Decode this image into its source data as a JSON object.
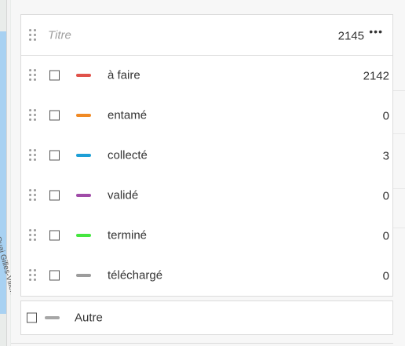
{
  "map": {
    "label": "Quai Gilles-Villeneu"
  },
  "legend": {
    "title_placeholder": "Titre",
    "total": "2145",
    "more_label": "•••",
    "items": [
      {
        "label": "à faire",
        "count": "2142",
        "color": "#e0524a"
      },
      {
        "label": "entamé",
        "count": "0",
        "color": "#f08a24"
      },
      {
        "label": "collecté",
        "count": "3",
        "color": "#1e9fd6"
      },
      {
        "label": "validé",
        "count": "0",
        "color": "#a04ca8"
      },
      {
        "label": "terminé",
        "count": "0",
        "color": "#45e640"
      },
      {
        "label": "téléchargé",
        "count": "0",
        "color": "#9c9c9c"
      }
    ],
    "other": {
      "label": "Autre",
      "color": "#a6a6a6"
    }
  }
}
